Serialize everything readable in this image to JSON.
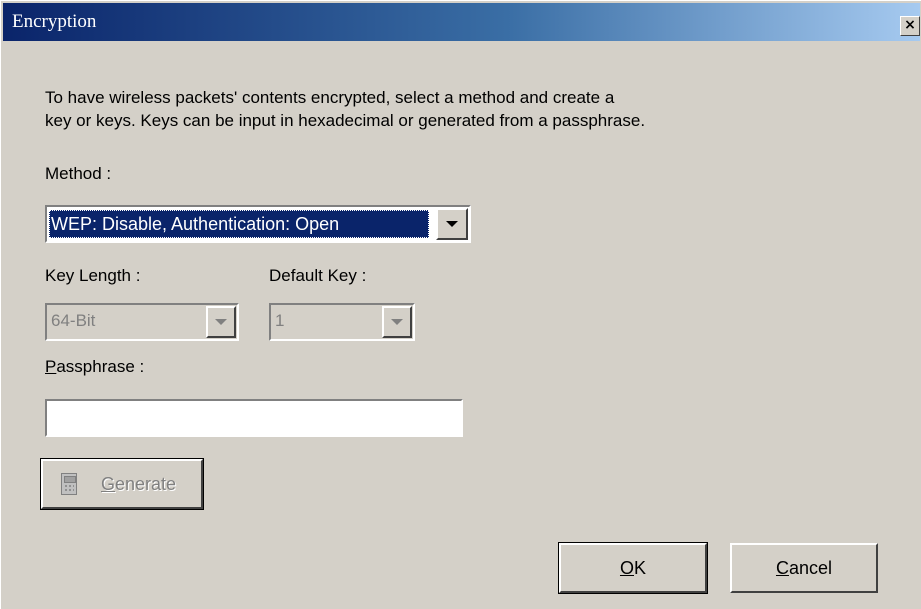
{
  "window": {
    "title": "Encryption",
    "close_glyph": "×"
  },
  "description": {
    "line1": "To have wireless packets' contents encrypted, select a method and create a",
    "line2": "key or keys. Keys can be input in hexadecimal or generated from a passphrase."
  },
  "method": {
    "label": "Method :",
    "selected": "WEP: Disable, Authentication: Open"
  },
  "key_length": {
    "label": "Key Length :",
    "selected": "64-Bit",
    "enabled": false
  },
  "default_key": {
    "label": "Default Key :",
    "selected": "1",
    "enabled": false
  },
  "passphrase": {
    "label_first": "P",
    "label_rest": "assphrase :",
    "value": ""
  },
  "generate": {
    "label_first": "G",
    "label_rest": "enerate",
    "icon": "calculator-icon",
    "enabled": false
  },
  "buttons": {
    "ok_first": "O",
    "ok_rest": "K",
    "cancel_first": "C",
    "cancel_rest": "ancel"
  },
  "icons": {
    "close": "close-icon",
    "dropdown": "chevron-down-icon"
  },
  "colors": {
    "face": "#d4d0c8",
    "title_start": "#0a246a",
    "title_end": "#a6caf0",
    "selection": "#0a246a",
    "disabled_text": "#808080"
  }
}
